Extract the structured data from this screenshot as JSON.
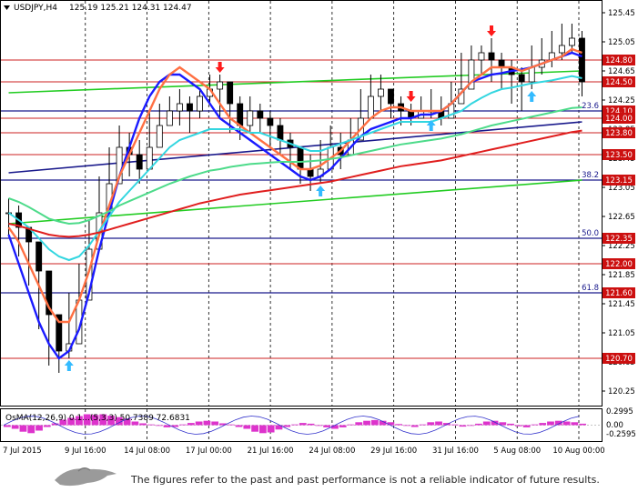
{
  "header": {
    "symbol": "USDJPY,H4",
    "ohlc": "125.19 125.21 124.31 124.47"
  },
  "osma": {
    "label": "OsMA(12,26,9) 0.1...(5,3,3) 50.7389 72.6831",
    "axis_labels": [
      "0.2995",
      "0.00",
      "-0.2595"
    ],
    "values": [
      -0.05,
      -0.1,
      -0.18,
      -0.22,
      -0.15,
      -0.05,
      0.05,
      0.15,
      0.2,
      0.25,
      0.3,
      0.28,
      0.3,
      0.26,
      0.22,
      0.18,
      0.1,
      0.05,
      0.02,
      -0.02,
      -0.06,
      -0.05,
      0.02,
      0.06,
      0.1,
      0.12,
      0.1,
      0.05,
      0.02,
      -0.05,
      -0.1,
      -0.18,
      -0.22,
      -0.2,
      -0.12,
      -0.05,
      0.02,
      0.06,
      0.04,
      -0.02,
      -0.06,
      -0.1,
      -0.06,
      0.02,
      0.08,
      0.12,
      0.14,
      0.12,
      0.08,
      0.03,
      -0.02,
      -0.05,
      0.02,
      0.08,
      0.1,
      0.06,
      0.02,
      -0.04,
      -0.02,
      0.04,
      0.1,
      0.12,
      0.08,
      0.04,
      -0.03,
      -0.06,
      0.02,
      0.06,
      0.1,
      0.12,
      0.1,
      0.08,
      0.04
    ]
  },
  "footer": {
    "disclaimer": "The figures refer to the past and past performance is not a reliable indicator of future results."
  },
  "chart_data": {
    "type": "candlestick",
    "symbol": "USDJPY",
    "timeframe": "H4",
    "ylim": [
      120.1,
      125.55
    ],
    "y_ticks": [
      125.45,
      125.05,
      124.65,
      124.25,
      123.85,
      123.45,
      123.05,
      122.65,
      122.25,
      121.85,
      121.45,
      121.05,
      120.65,
      120.25
    ],
    "x_labels": [
      "7 Jul 2015",
      "9 Jul 16:00",
      "14 Jul 08:00",
      "17 Jul 00:00",
      "21 Jul 16:00",
      "24 Jul 08:00",
      "29 Jul 16:00",
      "31 Jul 16:00",
      "5 Aug 08:00",
      "10 Aug 00:00"
    ],
    "levels": [
      {
        "price": 124.8,
        "label": "124.80"
      },
      {
        "price": 124.5,
        "label": "124.50"
      },
      {
        "price": 124.1,
        "label": "124.10"
      },
      {
        "price": 124.0,
        "label": "124.00"
      },
      {
        "price": 123.8,
        "label": "123.80"
      },
      {
        "price": 123.5,
        "label": "123.50"
      },
      {
        "price": 123.15,
        "label": "123.15"
      },
      {
        "price": 122.35,
        "label": "122.35"
      },
      {
        "price": 122.0,
        "label": "122.00"
      },
      {
        "price": 121.6,
        "label": "121.60"
      },
      {
        "price": 120.7,
        "label": "120.70"
      }
    ],
    "fibonacci": [
      {
        "price": 124.1,
        "label": "23.6"
      },
      {
        "price": 123.15,
        "label": "38.2"
      },
      {
        "price": 122.35,
        "label": "50.0"
      },
      {
        "price": 121.6,
        "label": "61.8"
      }
    ],
    "closes": [
      122.7,
      122.5,
      122.3,
      121.9,
      121.3,
      120.8,
      120.9,
      121.5,
      122.2,
      122.7,
      123.1,
      123.6,
      123.5,
      123.3,
      123.6,
      123.9,
      124.1,
      124.2,
      124.1,
      124.3,
      124.4,
      124.5,
      124.2,
      123.9,
      124.1,
      124.0,
      123.9,
      123.7,
      123.6,
      123.3,
      123.2,
      123.3,
      123.6,
      123.5,
      123.7,
      124.0,
      124.3,
      124.4,
      124.2,
      124.1,
      124.0,
      124.1,
      124.1,
      124.0,
      124.2,
      124.4,
      124.8,
      124.9,
      124.8,
      124.7,
      124.6,
      124.5,
      124.7,
      124.8,
      124.9,
      125.0,
      125.1,
      124.5
    ],
    "highs": [
      122.9,
      122.8,
      122.5,
      122.2,
      121.6,
      121.2,
      121.6,
      122.0,
      122.6,
      123.2,
      123.6,
      123.9,
      123.8,
      123.7,
      124.1,
      124.2,
      124.3,
      124.4,
      124.3,
      124.4,
      124.6,
      124.6,
      124.5,
      124.3,
      124.3,
      124.2,
      124.1,
      124.0,
      123.8,
      123.6,
      123.5,
      123.7,
      123.9,
      123.8,
      124.0,
      124.4,
      124.6,
      124.6,
      124.4,
      124.3,
      124.2,
      124.3,
      124.4,
      124.3,
      124.5,
      124.9,
      125.0,
      125.0,
      125.1,
      124.9,
      124.8,
      124.7,
      125.0,
      125.1,
      125.2,
      125.3,
      125.3,
      125.2
    ],
    "lows": [
      122.4,
      122.1,
      121.7,
      121.1,
      120.6,
      120.5,
      120.7,
      121.3,
      121.8,
      122.4,
      122.8,
      123.3,
      123.2,
      123.1,
      123.4,
      123.7,
      123.9,
      123.9,
      123.8,
      124.0,
      124.2,
      124.0,
      123.8,
      123.7,
      123.8,
      123.8,
      123.6,
      123.5,
      123.3,
      123.1,
      123.0,
      123.1,
      123.4,
      123.3,
      123.5,
      123.9,
      124.1,
      124.1,
      124.0,
      123.9,
      123.9,
      124.0,
      124.0,
      123.9,
      124.1,
      124.3,
      124.5,
      124.6,
      124.5,
      124.4,
      124.2,
      124.1,
      124.4,
      124.6,
      124.7,
      124.8,
      124.9,
      124.3
    ],
    "moving_averages": [
      {
        "color": "#1a1aff",
        "values": [
          122.4,
          122.0,
          121.6,
          121.2,
          120.9,
          120.7,
          120.8,
          121.1,
          121.6,
          122.2,
          122.7,
          123.2,
          123.6,
          124.0,
          124.3,
          124.5,
          124.6,
          124.6,
          124.5,
          124.4,
          124.2,
          124.0,
          123.9,
          123.8,
          123.7,
          123.6,
          123.5,
          123.4,
          123.3,
          123.2,
          123.15,
          123.2,
          123.3,
          123.45,
          123.6,
          123.75,
          123.85,
          123.9,
          123.95,
          124.0,
          124.0,
          124.05,
          124.05,
          124.1,
          124.2,
          124.35,
          124.5,
          124.55,
          124.6,
          124.62,
          124.65,
          124.67,
          124.7,
          124.75,
          124.8,
          124.85,
          124.9,
          124.85
        ]
      },
      {
        "color": "#ff7043",
        "values": [
          122.5,
          122.3,
          122.0,
          121.7,
          121.4,
          121.2,
          121.2,
          121.5,
          121.9,
          122.4,
          122.8,
          123.2,
          123.5,
          123.8,
          124.1,
          124.4,
          124.6,
          124.7,
          124.6,
          124.5,
          124.4,
          124.2,
          124.0,
          123.9,
          123.8,
          123.7,
          123.6,
          123.5,
          123.4,
          123.3,
          123.3,
          123.35,
          123.45,
          123.55,
          123.7,
          123.85,
          124.0,
          124.1,
          124.15,
          124.15,
          124.1,
          124.1,
          124.1,
          124.1,
          124.2,
          124.35,
          124.5,
          124.6,
          124.7,
          124.7,
          124.7,
          124.65,
          124.7,
          124.75,
          124.8,
          124.85,
          124.95,
          124.9
        ]
      },
      {
        "color": "#33d6e0",
        "values": [
          122.7,
          122.6,
          122.5,
          122.35,
          122.2,
          122.1,
          122.05,
          122.1,
          122.25,
          122.45,
          122.65,
          122.85,
          123.0,
          123.15,
          123.3,
          123.45,
          123.6,
          123.7,
          123.75,
          123.8,
          123.85,
          123.85,
          123.85,
          123.85,
          123.8,
          123.8,
          123.75,
          123.7,
          123.65,
          123.6,
          123.55,
          123.55,
          123.6,
          123.65,
          123.7,
          123.75,
          123.8,
          123.85,
          123.9,
          123.95,
          123.95,
          123.95,
          123.95,
          124.0,
          124.05,
          124.1,
          124.2,
          124.28,
          124.35,
          124.4,
          124.42,
          124.45,
          124.48,
          124.5,
          124.52,
          124.55,
          124.58,
          124.55
        ]
      },
      {
        "color": "#4ddb8a",
        "values": [
          122.9,
          122.85,
          122.78,
          122.7,
          122.62,
          122.58,
          122.55,
          122.56,
          122.6,
          122.66,
          122.72,
          122.8,
          122.86,
          122.92,
          122.98,
          123.04,
          123.1,
          123.15,
          123.2,
          123.24,
          123.28,
          123.3,
          123.33,
          123.35,
          123.37,
          123.38,
          123.39,
          123.4,
          123.4,
          123.4,
          123.41,
          123.42,
          123.44,
          123.46,
          123.49,
          123.52,
          123.55,
          123.58,
          123.61,
          123.64,
          123.66,
          123.68,
          123.7,
          123.72,
          123.75,
          123.78,
          123.82,
          123.86,
          123.9,
          123.93,
          123.96,
          123.99,
          124.02,
          124.05,
          124.08,
          124.11,
          124.14,
          124.15
        ]
      },
      {
        "color": "#e01e1e",
        "values": [
          122.55,
          122.52,
          122.48,
          122.44,
          122.4,
          122.38,
          122.37,
          122.38,
          122.4,
          122.43,
          122.47,
          122.51,
          122.55,
          122.59,
          122.63,
          122.67,
          122.71,
          122.75,
          122.79,
          122.83,
          122.86,
          122.89,
          122.92,
          122.95,
          122.97,
          122.99,
          123.01,
          123.03,
          123.05,
          123.07,
          123.09,
          123.11,
          123.13,
          123.16,
          123.19,
          123.22,
          123.25,
          123.28,
          123.31,
          123.34,
          123.36,
          123.38,
          123.4,
          123.42,
          123.45,
          123.48,
          123.51,
          123.54,
          123.57,
          123.6,
          123.63,
          123.66,
          123.69,
          123.72,
          123.75,
          123.78,
          123.81,
          123.83
        ]
      }
    ],
    "trendlines": [
      {
        "color": "#22cc22",
        "from": [
          0,
          122.55
        ],
        "to": [
          57,
          123.15
        ]
      },
      {
        "color": "#22cc22",
        "from": [
          0,
          124.35
        ],
        "to": [
          57,
          124.65
        ]
      },
      {
        "color": "#1a1a8c",
        "from": [
          0,
          123.25
        ],
        "to": [
          57,
          123.95
        ]
      }
    ],
    "arrows": [
      {
        "index": 21,
        "dir": "down",
        "color": "#ff1a1a"
      },
      {
        "index": 40,
        "dir": "down",
        "color": "#ff1a1a"
      },
      {
        "index": 48,
        "dir": "down",
        "color": "#ff1a1a"
      },
      {
        "index": 6,
        "dir": "up",
        "color": "#33bbff"
      },
      {
        "index": 31,
        "dir": "up",
        "color": "#33bbff"
      },
      {
        "index": 42,
        "dir": "up",
        "color": "#33bbff"
      },
      {
        "index": 52,
        "dir": "up",
        "color": "#33bbff"
      }
    ]
  }
}
